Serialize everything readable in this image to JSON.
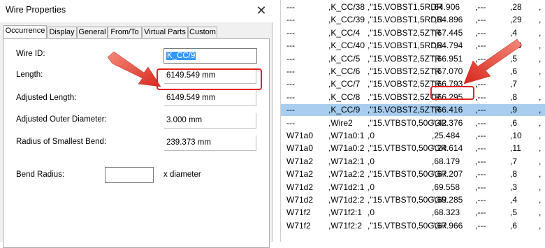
{
  "dialog": {
    "title": "Wire Properties",
    "close_glyph": "✕",
    "tabs": [
      {
        "label": "Occurrence",
        "active": true
      },
      {
        "label": "Display"
      },
      {
        "label": "General"
      },
      {
        "label": "From/To"
      },
      {
        "label": "Virtual Parts"
      },
      {
        "label": "Custom"
      }
    ],
    "fields": {
      "wire_id": {
        "label": "Wire ID:",
        "value": "K_CC/9"
      },
      "length": {
        "label": "Length:",
        "value": "6149.549 mm"
      },
      "adjusted_length": {
        "label": "Adjusted Length:",
        "value": "6149.549 mm"
      },
      "adjusted_outer_diameter": {
        "label": "Adjusted Outer Diameter:",
        "value": "3.000 mm"
      },
      "radius_smallest_bend": {
        "label": "Radius of Smallest Bend:",
        "value": "239.373 mm"
      },
      "bend_radius": {
        "label": "Bend Radius:",
        "value": "",
        "suffix": "x diameter"
      }
    }
  },
  "listing": {
    "rows": [
      {
        "c1": "---",
        "c2": ",K_CC/38",
        "c3": ",\"15.VOBST1,5RDR",
        "c4": ",64.906",
        "c5": ",---",
        "c6": ",28",
        "c7": ","
      },
      {
        "c1": "---",
        "c2": ",K_CC/39",
        "c3": ",\"15.VOBST1,5RDR",
        "c4": "\",64.896",
        "c5": ",---",
        "c6": ",29",
        "c7": ","
      },
      {
        "c1": "---",
        "c2": ",K_CC/4",
        "c3": ",\"15.VOBST2,5ZTR",
        "c4": "\",67.445",
        "c5": ",---",
        "c6": ",4",
        "c7": ","
      },
      {
        "c1": "---",
        "c2": ",K_CC/40",
        "c3": ",\"15.VOBST1,5RDR",
        "c4": "\",64.794",
        "c5": ",---",
        "c6": ",30",
        "c7": ","
      },
      {
        "c1": "---",
        "c2": ",K_CC/5",
        "c3": ",\"15.VOBST2,5ZTR",
        "c4": "\",66.951",
        "c5": ",---",
        "c6": ",5",
        "c7": ","
      },
      {
        "c1": "---",
        "c2": ",K_CC/6",
        "c3": ",\"15.VOBST2,5ZTR",
        "c4": "\",67.070",
        "c5": ",---",
        "c6": ",6",
        "c7": ","
      },
      {
        "c1": "---",
        "c2": ",K_CC/7",
        "c3": ",\"15.VOBST2,5ZTR",
        "c4": "\",66.793",
        "c5": ",---",
        "c6": ",7",
        "c7": ","
      },
      {
        "c1": "---",
        "c2": ",K_CC/8",
        "c3": ",\"15.VOBST2,5ZTR",
        "c4": "\",66.295",
        "c5": ",---",
        "c6": ",8",
        "c7": ","
      },
      {
        "c1": "---",
        "c2": ",K_CC/9",
        "c3": ",\"15.VOBST2,5ZTR",
        "c4": "\",66.416",
        "c5": ",---",
        "c6": ",9",
        "c7": ",",
        "selected": true
      },
      {
        "c1": "---",
        "c2": ",Wire2",
        "c3": ",\"15.VTBST0,50GGR",
        "c4": "\",42.376",
        "c5": ",---",
        "c6": ",6",
        "c7": ","
      },
      {
        "c1": "W71a0",
        "c2": ",W71a0:1",
        "c3": ",0",
        "c4": ",25.484",
        "c5": ",---",
        "c6": ",10",
        "c7": ","
      },
      {
        "c1": "W71a0",
        "c2": ",W71a0:2",
        "c3": ",\"15.VTBST0,50GGR",
        "c4": "\",24.614",
        "c5": ",---",
        "c6": ",11",
        "c7": ","
      },
      {
        "c1": "W71a2",
        "c2": ",W71a2:1",
        "c3": ",0",
        "c4": ",68.179",
        "c5": ",---",
        "c6": ",7",
        "c7": ","
      },
      {
        "c1": "W71a2",
        "c2": ",W71a2:2",
        "c3": ",\"15.VTBST0,50GGR",
        "c4": "\",67.207",
        "c5": ",---",
        "c6": ",8",
        "c7": ","
      },
      {
        "c1": "W71d2",
        "c2": ",W71d2:1",
        "c3": ",0",
        "c4": ",69.558",
        "c5": ",---",
        "c6": ",3",
        "c7": ","
      },
      {
        "c1": "W71d2",
        "c2": ",W71d2:2",
        "c3": ",\"15.VTBST0,50GGR",
        "c4": "\",69.285",
        "c5": ",---",
        "c6": ",4",
        "c7": ","
      },
      {
        "c1": "W71f2",
        "c2": ",W71f2:1",
        "c3": ",0",
        "c4": ",68.323",
        "c5": ",---",
        "c6": ",5",
        "c7": ","
      },
      {
        "c1": "W71f2",
        "c2": ",W71f2:2",
        "c3": ",\"15.VTBST0,50GGR",
        "c4": "\",67.966",
        "c5": ",---",
        "c6": ",6",
        "c7": ","
      }
    ]
  },
  "annotations": {
    "highlight_color": "#e02424",
    "arrow_color": "#e8362c",
    "selection_color": "#a8cdee"
  }
}
